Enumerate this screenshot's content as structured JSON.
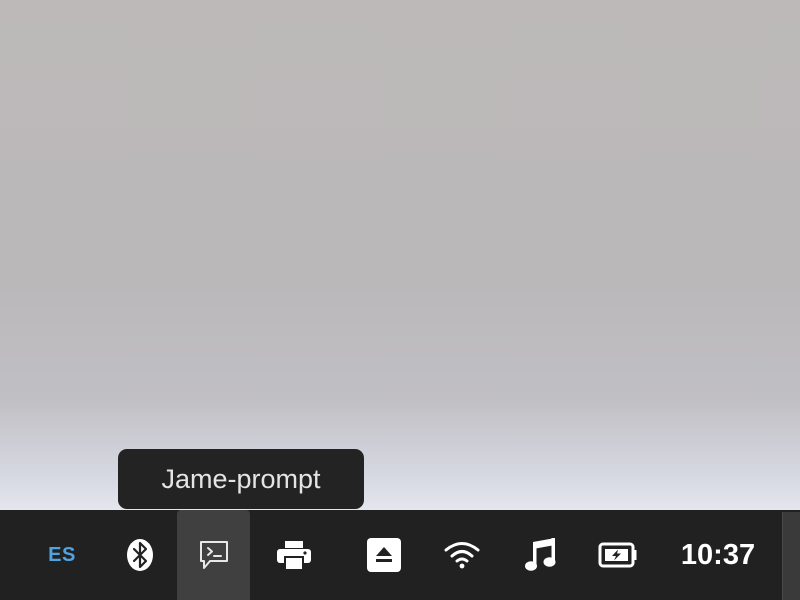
{
  "tooltip": {
    "text": "Jame-prompt"
  },
  "tray": {
    "language": "ES",
    "icons": [
      {
        "name": "bluetooth-icon"
      },
      {
        "name": "terminal-prompt-icon"
      },
      {
        "name": "printer-icon"
      },
      {
        "name": "eject-icon"
      },
      {
        "name": "wifi-icon"
      },
      {
        "name": "music-note-icon"
      },
      {
        "name": "battery-icon"
      }
    ],
    "clock": "10:37"
  },
  "colors": {
    "taskbar": "#212121",
    "active_item": "#404040",
    "language_text": "#4fa3e0",
    "tooltip_bg": "#232323",
    "tooltip_text": "#e4e4e4",
    "icon": "#ffffff"
  }
}
